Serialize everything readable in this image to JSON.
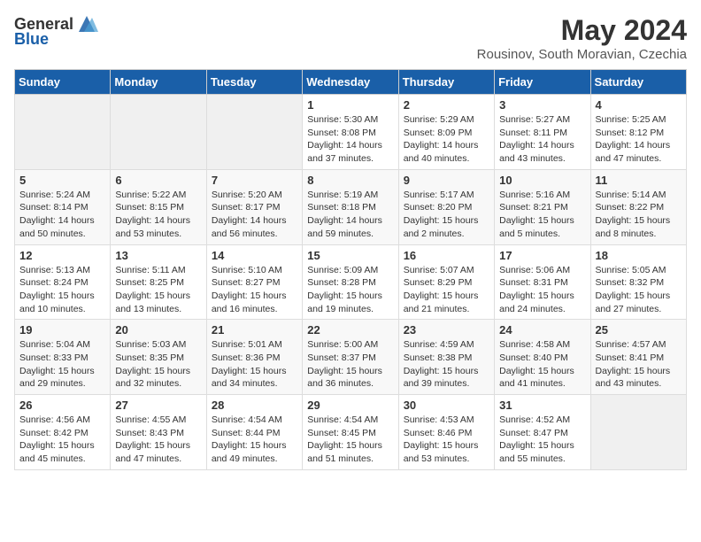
{
  "header": {
    "logo_general": "General",
    "logo_blue": "Blue",
    "month": "May 2024",
    "location": "Rousinov, South Moravian, Czechia"
  },
  "days_of_week": [
    "Sunday",
    "Monday",
    "Tuesday",
    "Wednesday",
    "Thursday",
    "Friday",
    "Saturday"
  ],
  "weeks": [
    [
      {
        "day": "",
        "info": ""
      },
      {
        "day": "",
        "info": ""
      },
      {
        "day": "",
        "info": ""
      },
      {
        "day": "1",
        "info": "Sunrise: 5:30 AM\nSunset: 8:08 PM\nDaylight: 14 hours\nand 37 minutes."
      },
      {
        "day": "2",
        "info": "Sunrise: 5:29 AM\nSunset: 8:09 PM\nDaylight: 14 hours\nand 40 minutes."
      },
      {
        "day": "3",
        "info": "Sunrise: 5:27 AM\nSunset: 8:11 PM\nDaylight: 14 hours\nand 43 minutes."
      },
      {
        "day": "4",
        "info": "Sunrise: 5:25 AM\nSunset: 8:12 PM\nDaylight: 14 hours\nand 47 minutes."
      }
    ],
    [
      {
        "day": "5",
        "info": "Sunrise: 5:24 AM\nSunset: 8:14 PM\nDaylight: 14 hours\nand 50 minutes."
      },
      {
        "day": "6",
        "info": "Sunrise: 5:22 AM\nSunset: 8:15 PM\nDaylight: 14 hours\nand 53 minutes."
      },
      {
        "day": "7",
        "info": "Sunrise: 5:20 AM\nSunset: 8:17 PM\nDaylight: 14 hours\nand 56 minutes."
      },
      {
        "day": "8",
        "info": "Sunrise: 5:19 AM\nSunset: 8:18 PM\nDaylight: 14 hours\nand 59 minutes."
      },
      {
        "day": "9",
        "info": "Sunrise: 5:17 AM\nSunset: 8:20 PM\nDaylight: 15 hours\nand 2 minutes."
      },
      {
        "day": "10",
        "info": "Sunrise: 5:16 AM\nSunset: 8:21 PM\nDaylight: 15 hours\nand 5 minutes."
      },
      {
        "day": "11",
        "info": "Sunrise: 5:14 AM\nSunset: 8:22 PM\nDaylight: 15 hours\nand 8 minutes."
      }
    ],
    [
      {
        "day": "12",
        "info": "Sunrise: 5:13 AM\nSunset: 8:24 PM\nDaylight: 15 hours\nand 10 minutes."
      },
      {
        "day": "13",
        "info": "Sunrise: 5:11 AM\nSunset: 8:25 PM\nDaylight: 15 hours\nand 13 minutes."
      },
      {
        "day": "14",
        "info": "Sunrise: 5:10 AM\nSunset: 8:27 PM\nDaylight: 15 hours\nand 16 minutes."
      },
      {
        "day": "15",
        "info": "Sunrise: 5:09 AM\nSunset: 8:28 PM\nDaylight: 15 hours\nand 19 minutes."
      },
      {
        "day": "16",
        "info": "Sunrise: 5:07 AM\nSunset: 8:29 PM\nDaylight: 15 hours\nand 21 minutes."
      },
      {
        "day": "17",
        "info": "Sunrise: 5:06 AM\nSunset: 8:31 PM\nDaylight: 15 hours\nand 24 minutes."
      },
      {
        "day": "18",
        "info": "Sunrise: 5:05 AM\nSunset: 8:32 PM\nDaylight: 15 hours\nand 27 minutes."
      }
    ],
    [
      {
        "day": "19",
        "info": "Sunrise: 5:04 AM\nSunset: 8:33 PM\nDaylight: 15 hours\nand 29 minutes."
      },
      {
        "day": "20",
        "info": "Sunrise: 5:03 AM\nSunset: 8:35 PM\nDaylight: 15 hours\nand 32 minutes."
      },
      {
        "day": "21",
        "info": "Sunrise: 5:01 AM\nSunset: 8:36 PM\nDaylight: 15 hours\nand 34 minutes."
      },
      {
        "day": "22",
        "info": "Sunrise: 5:00 AM\nSunset: 8:37 PM\nDaylight: 15 hours\nand 36 minutes."
      },
      {
        "day": "23",
        "info": "Sunrise: 4:59 AM\nSunset: 8:38 PM\nDaylight: 15 hours\nand 39 minutes."
      },
      {
        "day": "24",
        "info": "Sunrise: 4:58 AM\nSunset: 8:40 PM\nDaylight: 15 hours\nand 41 minutes."
      },
      {
        "day": "25",
        "info": "Sunrise: 4:57 AM\nSunset: 8:41 PM\nDaylight: 15 hours\nand 43 minutes."
      }
    ],
    [
      {
        "day": "26",
        "info": "Sunrise: 4:56 AM\nSunset: 8:42 PM\nDaylight: 15 hours\nand 45 minutes."
      },
      {
        "day": "27",
        "info": "Sunrise: 4:55 AM\nSunset: 8:43 PM\nDaylight: 15 hours\nand 47 minutes."
      },
      {
        "day": "28",
        "info": "Sunrise: 4:54 AM\nSunset: 8:44 PM\nDaylight: 15 hours\nand 49 minutes."
      },
      {
        "day": "29",
        "info": "Sunrise: 4:54 AM\nSunset: 8:45 PM\nDaylight: 15 hours\nand 51 minutes."
      },
      {
        "day": "30",
        "info": "Sunrise: 4:53 AM\nSunset: 8:46 PM\nDaylight: 15 hours\nand 53 minutes."
      },
      {
        "day": "31",
        "info": "Sunrise: 4:52 AM\nSunset: 8:47 PM\nDaylight: 15 hours\nand 55 minutes."
      },
      {
        "day": "",
        "info": ""
      }
    ]
  ]
}
